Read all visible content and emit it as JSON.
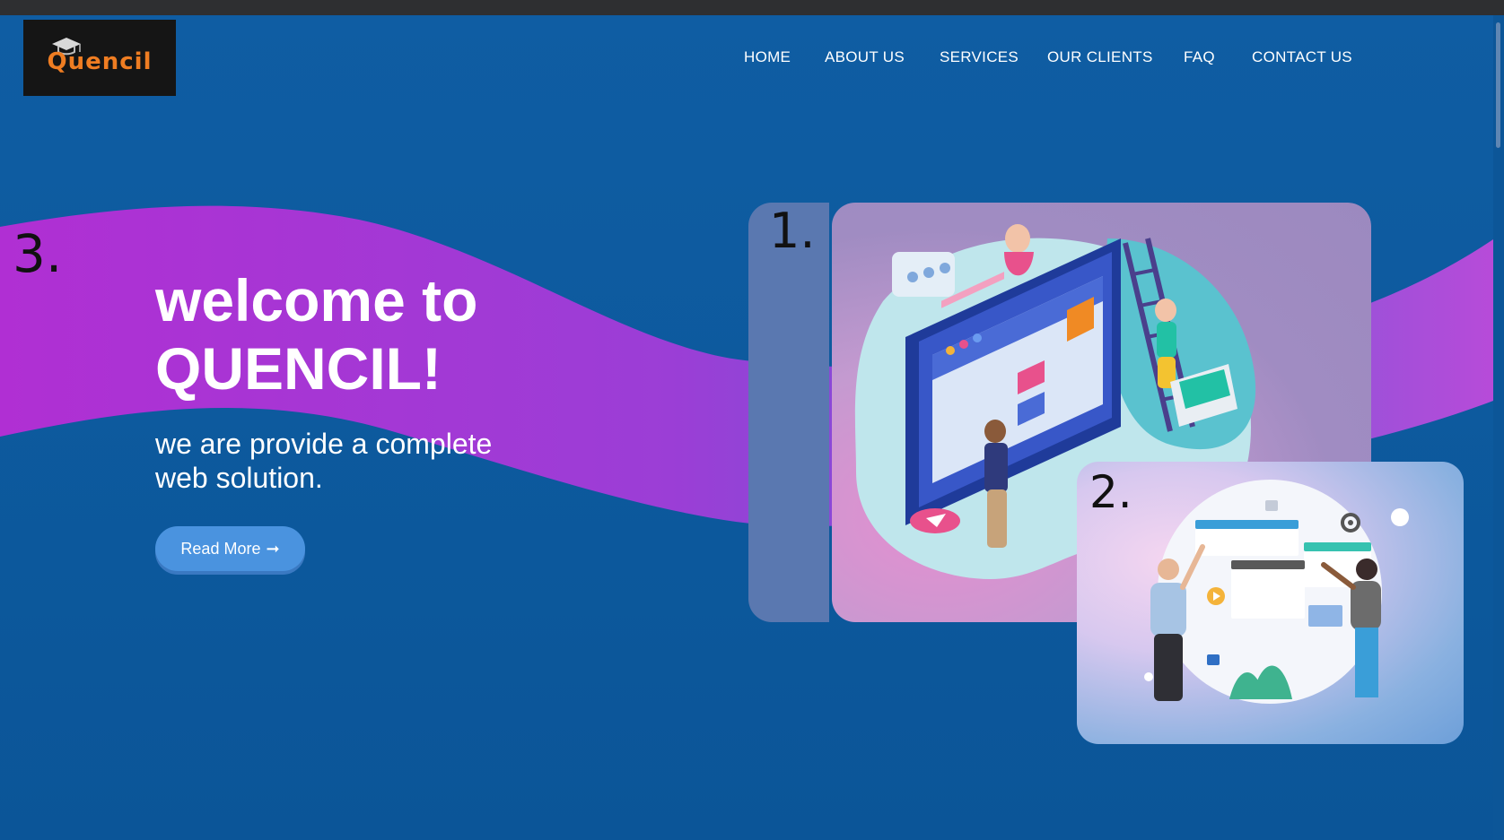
{
  "brand": {
    "logo_text": "Quencil"
  },
  "nav": {
    "items": [
      "HOME",
      "ABOUT US",
      "SERVICES",
      "OUR CLIENTS",
      "FAQ",
      "CONTACT US"
    ]
  },
  "hero": {
    "title_line1": "welcome to",
    "title_line2": "QUENCIL!",
    "subtitle_line1": "we are provide a complete",
    "subtitle_line2": "web solution.",
    "button_label": "Read More",
    "button_arrow": "➞"
  },
  "annotations": {
    "one": "1.",
    "two": "2.",
    "three": "3."
  },
  "colors": {
    "background": "#0d5a9e",
    "wave_start": "#b02fd3",
    "wave_end": "#6a58d8",
    "button": "#4a93df",
    "logo_orange": "#ef7d22"
  }
}
